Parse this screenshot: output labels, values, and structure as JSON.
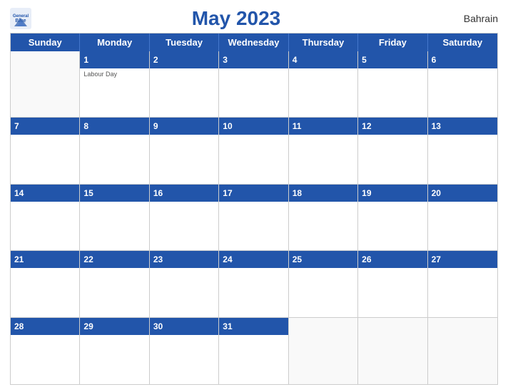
{
  "logo": {
    "line1": "General",
    "line2": "Blue"
  },
  "title": "May 2023",
  "country": "Bahrain",
  "days_of_week": [
    "Sunday",
    "Monday",
    "Tuesday",
    "Wednesday",
    "Thursday",
    "Friday",
    "Saturday"
  ],
  "weeks": [
    [
      {
        "day": "",
        "empty": true
      },
      {
        "day": "1",
        "event": "Labour Day"
      },
      {
        "day": "2"
      },
      {
        "day": "3"
      },
      {
        "day": "4"
      },
      {
        "day": "5"
      },
      {
        "day": "6"
      }
    ],
    [
      {
        "day": "7"
      },
      {
        "day": "8"
      },
      {
        "day": "9"
      },
      {
        "day": "10"
      },
      {
        "day": "11"
      },
      {
        "day": "12"
      },
      {
        "day": "13"
      }
    ],
    [
      {
        "day": "14"
      },
      {
        "day": "15"
      },
      {
        "day": "16"
      },
      {
        "day": "17"
      },
      {
        "day": "18"
      },
      {
        "day": "19"
      },
      {
        "day": "20"
      }
    ],
    [
      {
        "day": "21"
      },
      {
        "day": "22"
      },
      {
        "day": "23"
      },
      {
        "day": "24"
      },
      {
        "day": "25"
      },
      {
        "day": "26"
      },
      {
        "day": "27"
      }
    ],
    [
      {
        "day": "28"
      },
      {
        "day": "29"
      },
      {
        "day": "30"
      },
      {
        "day": "31"
      },
      {
        "day": ""
      },
      {
        "day": ""
      },
      {
        "day": ""
      }
    ]
  ],
  "colors": {
    "header_bg": "#2255aa",
    "header_text": "#ffffff",
    "day_number": "#2255aa"
  }
}
